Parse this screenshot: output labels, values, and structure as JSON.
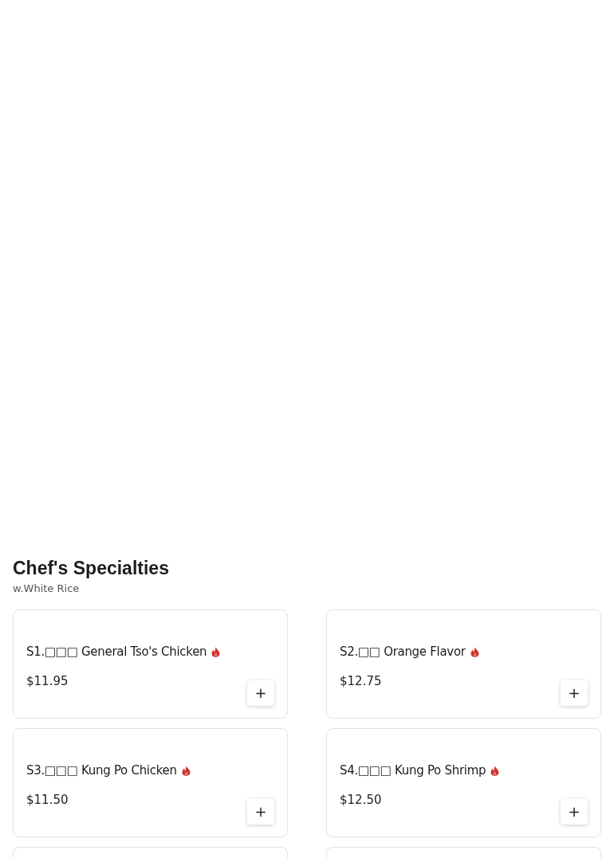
{
  "section": {
    "title": "Chef's Specialties",
    "subtitle": "w.White Rice"
  },
  "items": [
    {
      "name": "S1.□□□ General Tso's Chicken",
      "spicy": true,
      "price": "$11.95",
      "add_label": "+"
    },
    {
      "name": "S2.□□ Orange Flavor",
      "spicy": true,
      "price": "$12.75",
      "add_label": "+"
    },
    {
      "name": "S3.□□□ Kung Po Chicken",
      "spicy": true,
      "price": "$11.50",
      "add_label": "+"
    },
    {
      "name": "S4.□□□ Kung Po Shrimp",
      "spicy": true,
      "price": "$12.50",
      "add_label": "+"
    }
  ]
}
